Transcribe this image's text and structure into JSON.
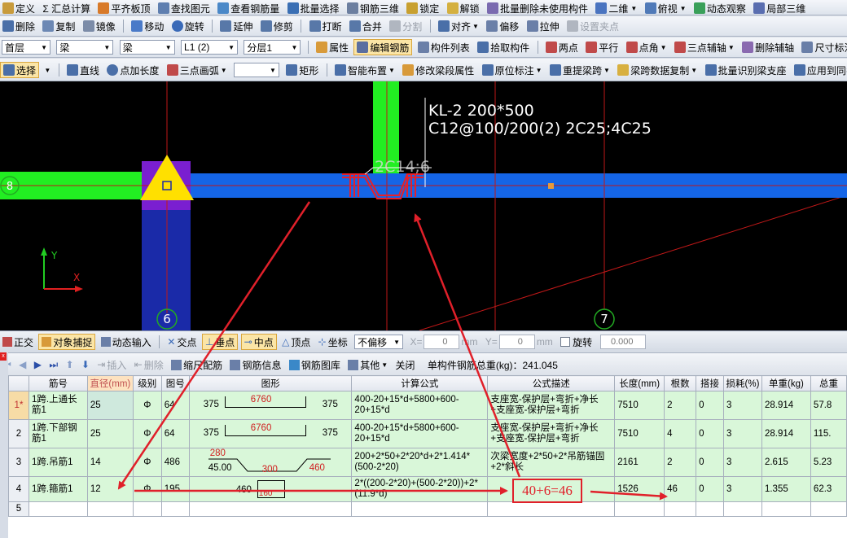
{
  "menu": [
    {
      "icon": "define-icon",
      "label": "定义"
    },
    {
      "icon": "sum-icon",
      "label": "Σ 汇总计算"
    },
    {
      "icon": "align-slab-icon",
      "label": "平齐板顶"
    },
    {
      "icon": "find-icon",
      "label": "查找图元"
    },
    {
      "icon": "rebar-qty-icon",
      "label": "查看钢筋量"
    },
    {
      "icon": "batch-select-icon",
      "label": "批量选择"
    },
    {
      "icon": "rebar-3d-icon",
      "label": "钢筋三维"
    },
    {
      "icon": "lock-icon",
      "label": "锁定"
    },
    {
      "icon": "unlock-icon",
      "label": "解锁"
    },
    {
      "icon": "delete-unused-icon",
      "label": "批量删除未使用构件"
    },
    {
      "icon": "view-2d-icon",
      "label": "二维"
    },
    {
      "icon": "top-view-icon",
      "label": "俯视"
    },
    {
      "icon": "dynamic-view-icon",
      "label": "动态观察"
    },
    {
      "icon": "local-3d-icon",
      "label": "局部三维"
    }
  ],
  "edit_toolbar": [
    {
      "label": "删除"
    },
    {
      "label": "复制"
    },
    {
      "label": "镜像"
    },
    {
      "label": "移动"
    },
    {
      "label": "旋转"
    },
    {
      "label": "延伸"
    },
    {
      "label": "修剪"
    },
    {
      "label": "打断"
    },
    {
      "label": "合并"
    },
    {
      "label": "分割",
      "disabled": true
    },
    {
      "label": "对齐"
    },
    {
      "label": "偏移"
    },
    {
      "label": "拉伸"
    },
    {
      "label": "设置夹点",
      "disabled": true
    }
  ],
  "selectors": {
    "floor": "首层",
    "category": "梁",
    "type": "梁",
    "member": "L1 (2)",
    "layer": "分层1"
  },
  "props_toolbar": [
    {
      "label": "属性"
    },
    {
      "label": "编辑钢筋",
      "active": true
    },
    {
      "label": "构件列表"
    },
    {
      "label": "拾取构件"
    },
    {
      "label": "两点"
    },
    {
      "label": "平行"
    },
    {
      "label": "点角"
    },
    {
      "label": "三点辅轴"
    },
    {
      "label": "删除辅轴"
    },
    {
      "label": "尺寸标注"
    }
  ],
  "draw_toolbar": [
    {
      "label": "选择",
      "active": true
    },
    {
      "label": "直线"
    },
    {
      "label": "点加长度"
    },
    {
      "label": "三点画弧"
    },
    {
      "label": "矩形"
    },
    {
      "label": "智能布置"
    },
    {
      "label": "修改梁段属性"
    },
    {
      "label": "原位标注"
    },
    {
      "label": "重提梁跨"
    },
    {
      "label": "梁跨数据复制"
    },
    {
      "label": "批量识别梁支座"
    },
    {
      "label": "应用到同名梁"
    }
  ],
  "canvas": {
    "beam_name": "KL-2 200*500",
    "beam_rebar": "C12@100/200(2) 2C25;4C25",
    "hanger_label": "2C14;6",
    "axes": [
      "8",
      "6",
      "7"
    ],
    "ucs_x": "X",
    "ucs_y": "Y",
    "colors": {
      "beam": "#1565e6",
      "wall": "#22ee22",
      "column": "#1a2aa8",
      "axis": "#c01818",
      "stirrup": "#e6202a",
      "marker": "#ffe000",
      "purple": "#7a1fd0"
    }
  },
  "snap_bar": {
    "ortho": "正交",
    "snap": "对象捕捉",
    "dyn_input": "动态输入",
    "intersect": "交点",
    "perp": "垂点",
    "mid": "中点",
    "vertex": "顶点",
    "coord": "坐标",
    "offset_mode": "不偏移",
    "x_label": "X=",
    "x_val": "0",
    "y_label": "Y=",
    "y_val": "0",
    "unit": "mm",
    "rotate": "旋转",
    "rotate_val": "0.000"
  },
  "panel_toolbar": {
    "insert": "插入",
    "delete": "删除",
    "scale": "缩尺配筋",
    "rebar_info": "钢筋信息",
    "rebar_lib": "钢筋图库",
    "other": "其他",
    "close": "关闭",
    "total": "单构件钢筋总重(kg)：241.045"
  },
  "table": {
    "headers": [
      "筋号",
      "直径(mm)",
      "级别",
      "图号",
      "图形",
      "计算公式",
      "公式描述",
      "长度(mm)",
      "根数",
      "搭接",
      "损耗(%)",
      "单重(kg)",
      "总重"
    ],
    "rows": [
      {
        "no": "1*",
        "name": "1跨.上通长筋1",
        "dia": "25",
        "grade": "Φ",
        "fig": "64",
        "shape": {
          "l": "375",
          "m": "6760",
          "r": "375"
        },
        "formula": "400-20+15*d+5800+600-20+15*d",
        "desc": "支座宽-保护层+弯折+净长+支座宽-保护层+弯折",
        "len": "7510",
        "count": "2",
        "lap": "0",
        "loss": "3",
        "unit": "28.914",
        "total": "57.8"
      },
      {
        "no": "2",
        "name": "1跨.下部钢筋1",
        "dia": "25",
        "grade": "Φ",
        "fig": "64",
        "shape": {
          "l": "375",
          "m": "6760",
          "r": "375"
        },
        "formula": "400-20+15*d+5800+600-20+15*d",
        "desc": "支座宽-保护层+弯折+净长+支座宽-保护层+弯折",
        "len": "7510",
        "count": "4",
        "lap": "0",
        "loss": "3",
        "unit": "28.914",
        "total": "115."
      },
      {
        "no": "3",
        "name": "1跨.吊筋1",
        "dia": "14",
        "grade": "Φ",
        "fig": "486",
        "shape": {
          "top": "280",
          "left": "45.00",
          "mid": "300",
          "right": "460"
        },
        "formula": "200+2*50+2*20*d+2*1.414*(500-2*20)",
        "desc": "次梁宽度+2*50+2*吊筋锚固+2*斜长",
        "len": "2161",
        "count": "2",
        "lap": "0",
        "loss": "3",
        "unit": "2.615",
        "total": "5.23"
      },
      {
        "no": "4",
        "name": "1跨.箍筋1",
        "dia": "12",
        "grade": "Φ",
        "fig": "195",
        "shape": {
          "l": "460",
          "m": "160"
        },
        "formula": "2*((200-2*20)+(500-2*20))+2*(11.9*d)",
        "desc": "",
        "len": "1526",
        "count": "46",
        "lap": "0",
        "loss": "3",
        "unit": "1.355",
        "total": "62.3"
      },
      {
        "no": "5"
      }
    ]
  },
  "annotation": {
    "formula": "40+6=46",
    "color": "#e0202a"
  }
}
